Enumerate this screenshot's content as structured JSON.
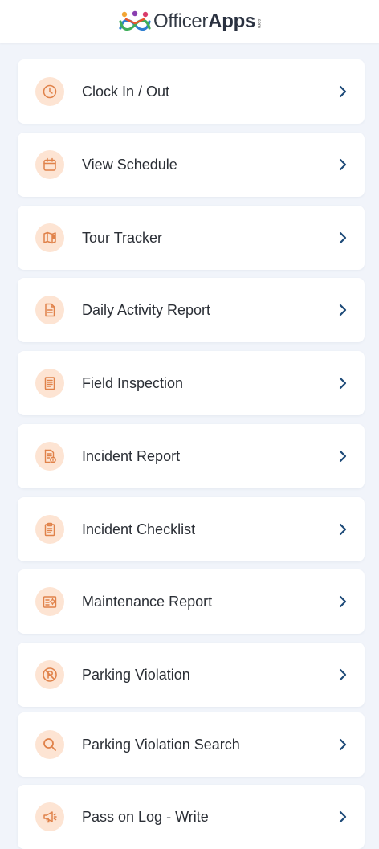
{
  "header": {
    "brand_light": "Officer",
    "brand_bold": "Apps",
    "brand_suffix": ".com"
  },
  "colors": {
    "accent": "#e0824a",
    "icon_bg": "#fde4d3",
    "chevron": "#1d4a78",
    "background": "#f1f4fa"
  },
  "menu": {
    "items": [
      {
        "label": "Clock In / Out",
        "icon": "clock-icon"
      },
      {
        "label": "View Schedule",
        "icon": "calendar-icon"
      },
      {
        "label": "Tour Tracker",
        "icon": "map-icon"
      },
      {
        "label": "Daily Activity Report",
        "icon": "document-icon"
      },
      {
        "label": "Field Inspection",
        "icon": "clipboard-list-icon"
      },
      {
        "label": "Incident Report",
        "icon": "document-alert-icon"
      },
      {
        "label": "Incident Checklist",
        "icon": "checklist-icon"
      },
      {
        "label": "Maintenance Report",
        "icon": "maintenance-icon"
      },
      {
        "label": "Parking Violation",
        "icon": "no-parking-icon"
      },
      {
        "label": "Parking Violation Search",
        "icon": "search-icon"
      },
      {
        "label": "Pass on Log - Write",
        "icon": "megaphone-icon"
      }
    ]
  }
}
